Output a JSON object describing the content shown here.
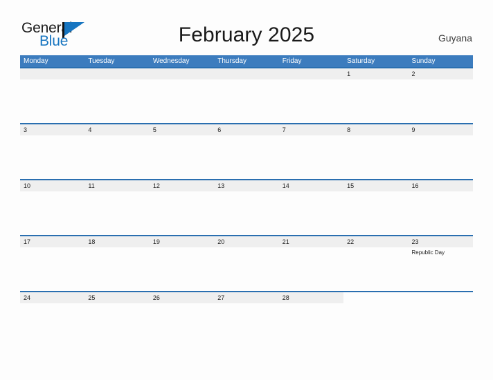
{
  "brand": {
    "name_part1": "General",
    "name_part2": "Blue",
    "logo_icon": "flag-triangle-icon"
  },
  "header": {
    "title": "February 2025",
    "country": "Guyana"
  },
  "colors": {
    "header_blue": "#3c7cbe",
    "separator_blue": "#2a6fb0",
    "band_gray": "#efefef",
    "brand_blue": "#1775c0",
    "page_background": "#fdfdfd"
  },
  "calendar": {
    "month": "February",
    "year": "2025",
    "weekday_headers": [
      "Monday",
      "Tuesday",
      "Wednesday",
      "Thursday",
      "Friday",
      "Saturday",
      "Sunday"
    ],
    "weeks": [
      {
        "filled_columns": 7,
        "band_start_column": 0,
        "days": [
          {
            "number": "",
            "event": ""
          },
          {
            "number": "",
            "event": ""
          },
          {
            "number": "",
            "event": ""
          },
          {
            "number": "",
            "event": ""
          },
          {
            "number": "",
            "event": ""
          },
          {
            "number": "1",
            "event": ""
          },
          {
            "number": "2",
            "event": ""
          }
        ]
      },
      {
        "filled_columns": 7,
        "band_start_column": 0,
        "days": [
          {
            "number": "3",
            "event": ""
          },
          {
            "number": "4",
            "event": ""
          },
          {
            "number": "5",
            "event": ""
          },
          {
            "number": "6",
            "event": ""
          },
          {
            "number": "7",
            "event": ""
          },
          {
            "number": "8",
            "event": ""
          },
          {
            "number": "9",
            "event": ""
          }
        ]
      },
      {
        "filled_columns": 7,
        "band_start_column": 0,
        "days": [
          {
            "number": "10",
            "event": ""
          },
          {
            "number": "11",
            "event": ""
          },
          {
            "number": "12",
            "event": ""
          },
          {
            "number": "13",
            "event": ""
          },
          {
            "number": "14",
            "event": ""
          },
          {
            "number": "15",
            "event": ""
          },
          {
            "number": "16",
            "event": ""
          }
        ]
      },
      {
        "filled_columns": 7,
        "band_start_column": 0,
        "days": [
          {
            "number": "17",
            "event": ""
          },
          {
            "number": "18",
            "event": ""
          },
          {
            "number": "19",
            "event": ""
          },
          {
            "number": "20",
            "event": ""
          },
          {
            "number": "21",
            "event": ""
          },
          {
            "number": "22",
            "event": ""
          },
          {
            "number": "23",
            "event": "Republic Day"
          }
        ]
      },
      {
        "filled_columns": 5,
        "band_start_column": 0,
        "days": [
          {
            "number": "24",
            "event": ""
          },
          {
            "number": "25",
            "event": ""
          },
          {
            "number": "26",
            "event": ""
          },
          {
            "number": "27",
            "event": ""
          },
          {
            "number": "28",
            "event": ""
          },
          {
            "number": "",
            "event": ""
          },
          {
            "number": "",
            "event": ""
          }
        ]
      }
    ]
  }
}
